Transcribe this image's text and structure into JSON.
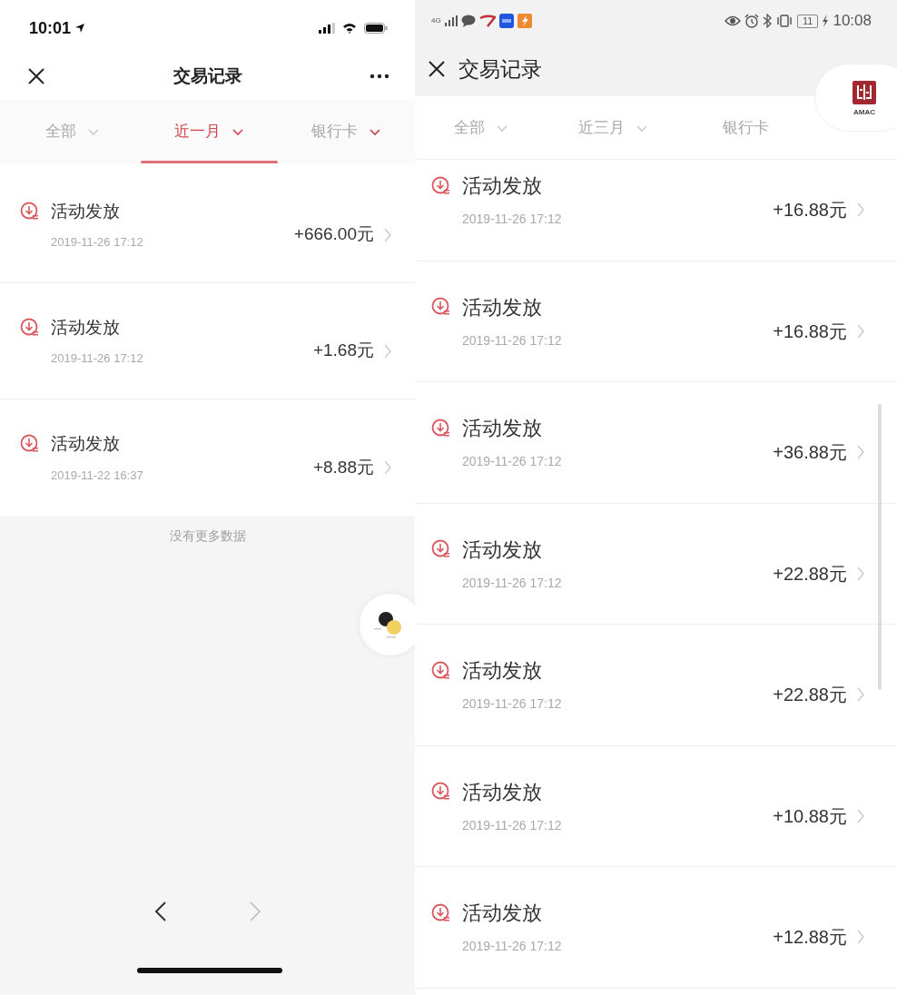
{
  "phones": [
    {
      "kind": "ios",
      "status_bar": {
        "time": "10:01"
      },
      "title": "交易记录",
      "filters": [
        {
          "label": "全部",
          "selected": false
        },
        {
          "label": "近一月",
          "selected": true
        },
        {
          "label": "银行卡",
          "selected": false
        }
      ],
      "records": [
        {
          "title": "活动发放",
          "time": "2019-11-26 17:12",
          "amount": "+666.00元"
        },
        {
          "title": "活动发放",
          "time": "2019-11-26 17:12",
          "amount": "+1.68元"
        },
        {
          "title": "活动发放",
          "time": "2019-11-22 16:37",
          "amount": "+8.88元"
        }
      ],
      "end_note": "没有更多数据"
    },
    {
      "kind": "android",
      "status_bar": {
        "time": "10:08",
        "battery": "11",
        "network": "4G"
      },
      "title": "交易记录",
      "badge": {
        "text": "AMAC"
      },
      "filters": [
        {
          "label": "全部",
          "selected": false
        },
        {
          "label": "近三月",
          "selected": false
        },
        {
          "label": "银行卡",
          "selected": false
        }
      ],
      "records": [
        {
          "title": "活动发放",
          "time": "2019-11-26 17:12",
          "amount": "+16.88元"
        },
        {
          "title": "活动发放",
          "time": "2019-11-26 17:12",
          "amount": "+16.88元"
        },
        {
          "title": "活动发放",
          "time": "2019-11-26 17:12",
          "amount": "+36.88元"
        },
        {
          "title": "活动发放",
          "time": "2019-11-26 17:12",
          "amount": "+22.88元"
        },
        {
          "title": "活动发放",
          "time": "2019-11-26 17:12",
          "amount": "+22.88元"
        },
        {
          "title": "活动发放",
          "time": "2019-11-26 17:12",
          "amount": "+10.88元"
        },
        {
          "title": "活动发放",
          "time": "2019-11-26 17:12",
          "amount": "+12.88元"
        }
      ]
    }
  ]
}
